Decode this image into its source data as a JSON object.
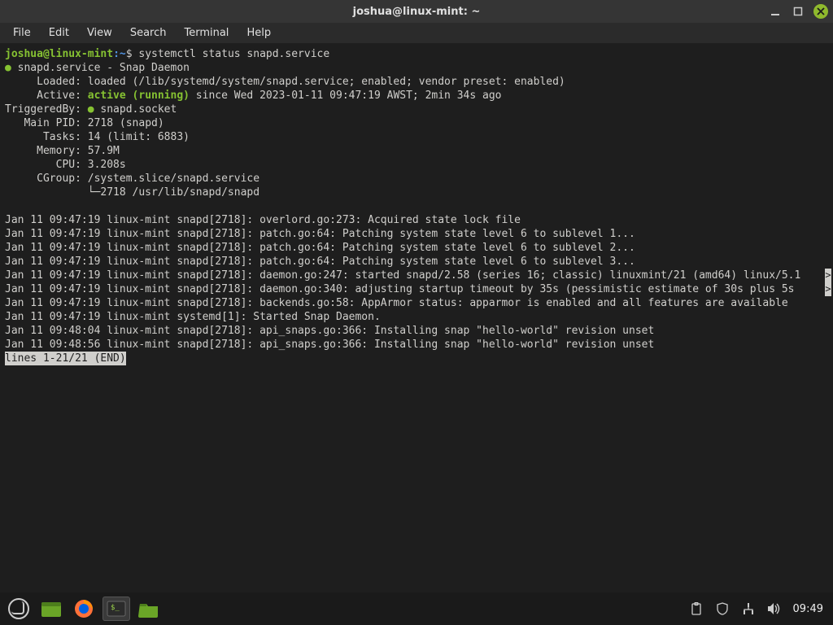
{
  "window": {
    "title": "joshua@linux-mint: ~",
    "menus": [
      "File",
      "Edit",
      "View",
      "Search",
      "Terminal",
      "Help"
    ]
  },
  "prompt": {
    "user": "joshua@linux-mint",
    "sep": ":",
    "path": "~",
    "symbol": "$",
    "command": "systemctl status snapd.service"
  },
  "status": {
    "unit_line": "snapd.service - Snap Daemon",
    "loaded_label": "     Loaded: ",
    "loaded_value": "loaded (/lib/systemd/system/snapd.service; enabled; vendor preset: enabled)",
    "active_label": "     Active: ",
    "active_green": "active (running)",
    "active_rest": " since Wed 2023-01-11 09:47:19 AWST; 2min 34s ago",
    "triggeredby_label": "TriggeredBy: ",
    "triggeredby_value": " snapd.socket",
    "mainpid_label": "   Main PID: ",
    "mainpid_value": "2718 (snapd)",
    "tasks_label": "      Tasks: ",
    "tasks_value": "14 (limit: 6883)",
    "memory_label": "     Memory: ",
    "memory_value": "57.9M",
    "cpu_label": "        CPU: ",
    "cpu_value": "3.208s",
    "cgroup_label": "     CGroup: ",
    "cgroup_value": "/system.slice/snapd.service",
    "cgroup_tree": "             └─2718 /usr/lib/snapd/snapd"
  },
  "log": [
    "Jan 11 09:47:19 linux-mint snapd[2718]: overlord.go:273: Acquired state lock file",
    "Jan 11 09:47:19 linux-mint snapd[2718]: patch.go:64: Patching system state level 6 to sublevel 1...",
    "Jan 11 09:47:19 linux-mint snapd[2718]: patch.go:64: Patching system state level 6 to sublevel 2...",
    "Jan 11 09:47:19 linux-mint snapd[2718]: patch.go:64: Patching system state level 6 to sublevel 3...",
    "Jan 11 09:47:19 linux-mint snapd[2718]: daemon.go:247: started snapd/2.58 (series 16; classic) linuxmint/21 (amd64) linux/5.1",
    "Jan 11 09:47:19 linux-mint snapd[2718]: daemon.go:340: adjusting startup timeout by 35s (pessimistic estimate of 30s plus 5s ",
    "Jan 11 09:47:19 linux-mint snapd[2718]: backends.go:58: AppArmor status: apparmor is enabled and all features are available",
    "Jan 11 09:47:19 linux-mint systemd[1]: Started Snap Daemon.",
    "Jan 11 09:48:04 linux-mint snapd[2718]: api_snaps.go:366: Installing snap \"hello-world\" revision unset",
    "Jan 11 09:48:56 linux-mint snapd[2718]: api_snaps.go:366: Installing snap \"hello-world\" revision unset"
  ],
  "pager": {
    "end": "lines 1-21/21 (END)"
  },
  "overflow_marker": ">",
  "panel": {
    "clock": "09:49"
  }
}
